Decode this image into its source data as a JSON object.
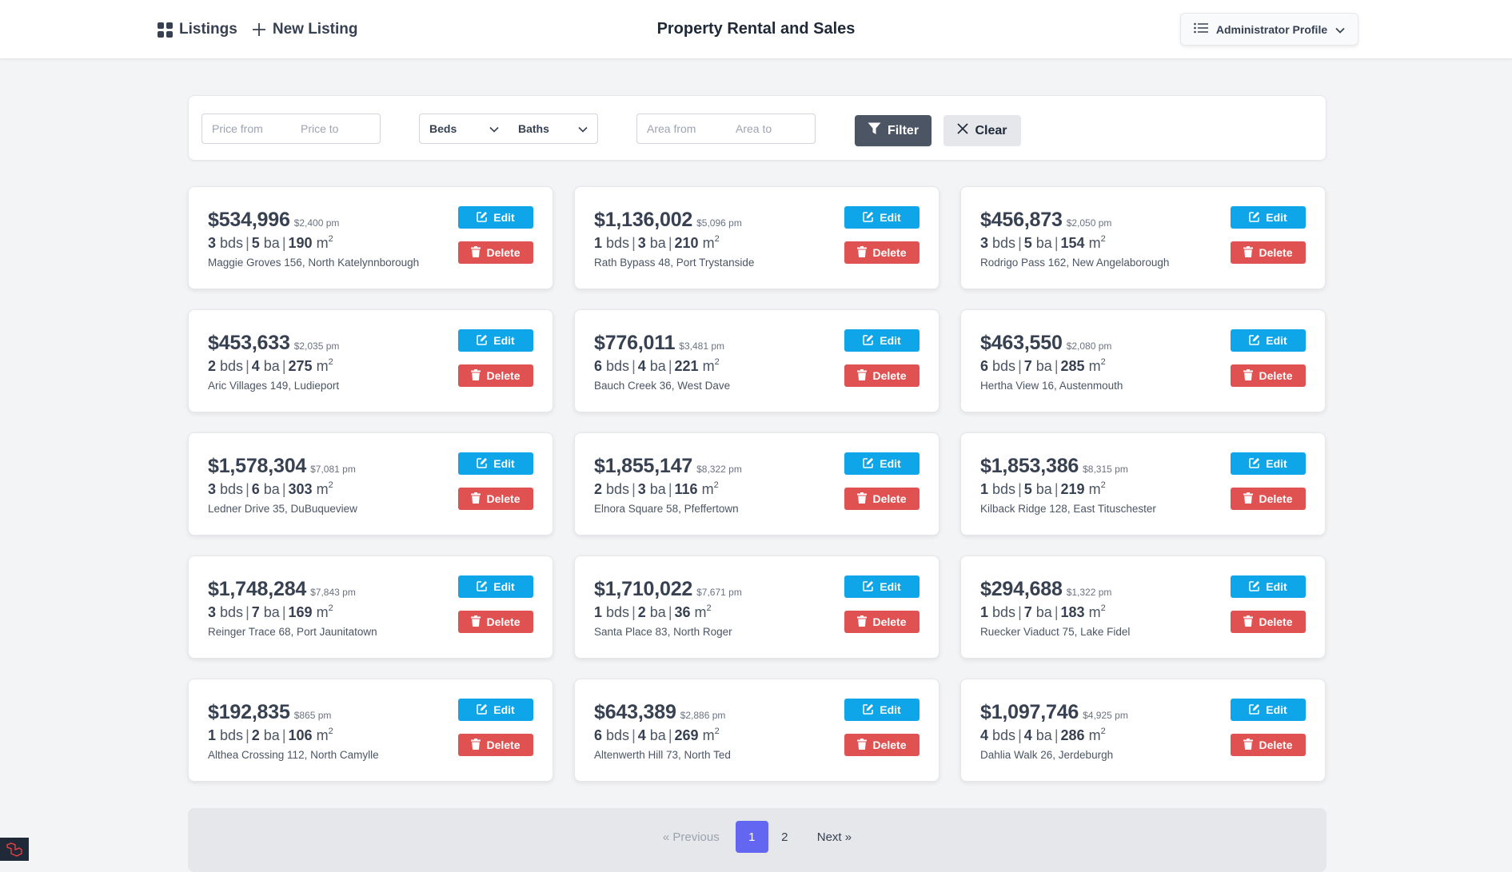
{
  "nav": {
    "listings_label": "Listings",
    "new_listing_label": "New Listing",
    "title": "Property Rental and Sales",
    "profile_label": "Administrator Profile"
  },
  "filter": {
    "price_from_placeholder": "Price from",
    "price_to_placeholder": "Price to",
    "beds_label": "Beds",
    "baths_label": "Baths",
    "area_from_placeholder": "Area from",
    "area_to_placeholder": "Area to",
    "filter_label": "Filter",
    "clear_label": "Clear"
  },
  "card_labels": {
    "edit": "Edit",
    "delete": "Delete",
    "beds_unit": "bds",
    "baths_unit": "ba",
    "area_unit": "m",
    "area_exp": "2",
    "separator": "|"
  },
  "listings": [
    {
      "price": "$534,996",
      "monthly": "$2,400 pm",
      "beds": "3",
      "baths": "5",
      "area": "190",
      "address": "Maggie Groves 156, North Katelynnborough"
    },
    {
      "price": "$1,136,002",
      "monthly": "$5,096 pm",
      "beds": "1",
      "baths": "3",
      "area": "210",
      "address": "Rath Bypass 48, Port Trystanside"
    },
    {
      "price": "$456,873",
      "monthly": "$2,050 pm",
      "beds": "3",
      "baths": "5",
      "area": "154",
      "address": "Rodrigo Pass 162, New Angelaborough"
    },
    {
      "price": "$453,633",
      "monthly": "$2,035 pm",
      "beds": "2",
      "baths": "4",
      "area": "275",
      "address": "Aric Villages 149, Ludieport"
    },
    {
      "price": "$776,011",
      "monthly": "$3,481 pm",
      "beds": "6",
      "baths": "4",
      "area": "221",
      "address": "Bauch Creek 36, West Dave"
    },
    {
      "price": "$463,550",
      "monthly": "$2,080 pm",
      "beds": "6",
      "baths": "7",
      "area": "285",
      "address": "Hertha View 16, Austenmouth"
    },
    {
      "price": "$1,578,304",
      "monthly": "$7,081 pm",
      "beds": "3",
      "baths": "6",
      "area": "303",
      "address": "Ledner Drive 35, DuBuqueview"
    },
    {
      "price": "$1,855,147",
      "monthly": "$8,322 pm",
      "beds": "2",
      "baths": "3",
      "area": "116",
      "address": "Elnora Square 58, Pfeffertown"
    },
    {
      "price": "$1,853,386",
      "monthly": "$8,315 pm",
      "beds": "1",
      "baths": "5",
      "area": "219",
      "address": "Kilback Ridge 128, East Titusche­ster"
    },
    {
      "price": "$1,748,284",
      "monthly": "$7,843 pm",
      "beds": "3",
      "baths": "7",
      "area": "169",
      "address": "Reinger Trace 68, Port Jaunitatown"
    },
    {
      "price": "$1,710,022",
      "monthly": "$7,671 pm",
      "beds": "1",
      "baths": "2",
      "area": "36",
      "address": "Santa Place 83, North Roger"
    },
    {
      "price": "$294,688",
      "monthly": "$1,322 pm",
      "beds": "1",
      "baths": "7",
      "area": "183",
      "address": "Ruecker Viaduct 75, Lake Fidel"
    },
    {
      "price": "$192,835",
      "monthly": "$865 pm",
      "beds": "1",
      "baths": "2",
      "area": "106",
      "address": "Althea Crossing 112, North Camylle"
    },
    {
      "price": "$643,389",
      "monthly": "$2,886 pm",
      "beds": "6",
      "baths": "4",
      "area": "269",
      "address": "Altenwerth Hill 73, North Ted"
    },
    {
      "price": "$1,097,746",
      "monthly": "$4,925 pm",
      "beds": "4",
      "baths": "4",
      "area": "286",
      "address": "Dahlia Walk 26, Jerdeburgh"
    }
  ],
  "pagination": {
    "previous_label": "« Previous",
    "pages": [
      "1",
      "2"
    ],
    "current": "1",
    "next_label": "Next »"
  },
  "colors": {
    "edit": "#0ea5e9",
    "delete": "#e05252",
    "filter": "#4b5563",
    "active_page": "#6366f1"
  },
  "icons": {
    "listings": "grid-icon",
    "new_listing": "plus-icon",
    "profile": "list-icon",
    "profile_caret": "chevron-down-icon",
    "filter": "funnel-icon",
    "clear": "x-icon",
    "edit": "pencil-square-icon",
    "delete": "trash-icon"
  }
}
